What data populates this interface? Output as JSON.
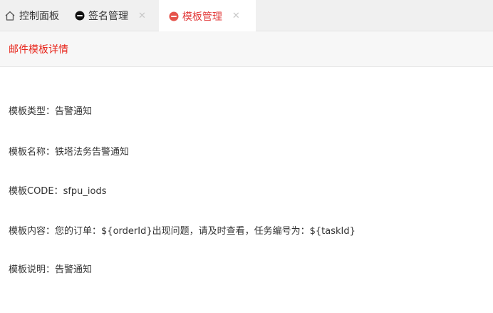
{
  "tabs": [
    {
      "label": "控制面板",
      "icon": "home-icon",
      "closable": false
    },
    {
      "label": "签名管理",
      "icon": "circle-minus-icon",
      "closable": true
    },
    {
      "label": "模板管理",
      "icon": "circle-minus-icon",
      "closable": true,
      "active": true
    }
  ],
  "close_glyph": "✕",
  "colors": {
    "accent_red": "#e8281e",
    "tab_active_icon": "#e5534b",
    "tab_inactive_icon": "#111111"
  },
  "subheader": {
    "title": "邮件模板详情"
  },
  "details": {
    "separator": "：",
    "rows": [
      {
        "label": "模板类型",
        "value": "告警通知"
      },
      {
        "label": "模板名称",
        "value": "铁塔法务告警通知"
      },
      {
        "label": "模板CODE",
        "value": "sfpu_iods"
      },
      {
        "label": "模板内容",
        "value": "您的订单：${orderId}出现问题，请及时查看，任务编号为：${taskId}"
      },
      {
        "label": "模板说明",
        "value": "告警通知"
      }
    ]
  }
}
